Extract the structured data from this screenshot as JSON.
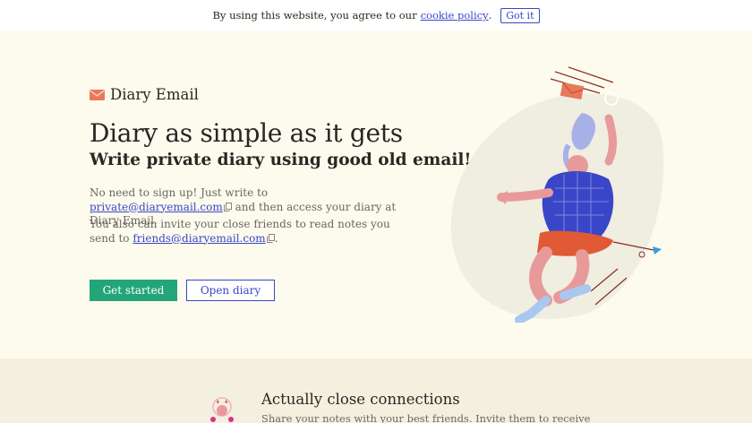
{
  "cookie": {
    "text": "By using this website, you agree to our",
    "link": "cookie policy",
    "period": ".",
    "button": "Got it"
  },
  "brand": {
    "name": "Diary Email",
    "icon": "envelope-icon"
  },
  "hero": {
    "title": "Diary as simple as it gets",
    "subtitle": "Write private diary using good old email!",
    "p1_before": "No need to sign up! Just write to ",
    "p1_email": "private@diaryemail.com",
    "p1_after": " and then access your diary at Diary Email.",
    "p2_before": "You also can invite your close friends to read notes you send to ",
    "p2_email": "friends@diaryemail.com",
    "p2_after": ".",
    "primary_button": "Get started",
    "secondary_button": "Open diary"
  },
  "feature": {
    "title": "Actually close connections",
    "text": "Share your notes with your best friends. Invite them to receive"
  },
  "colors": {
    "background": "#fdfbee",
    "accent": "#24a579",
    "link": "#3a46c8",
    "section": "#f4f0e0"
  }
}
